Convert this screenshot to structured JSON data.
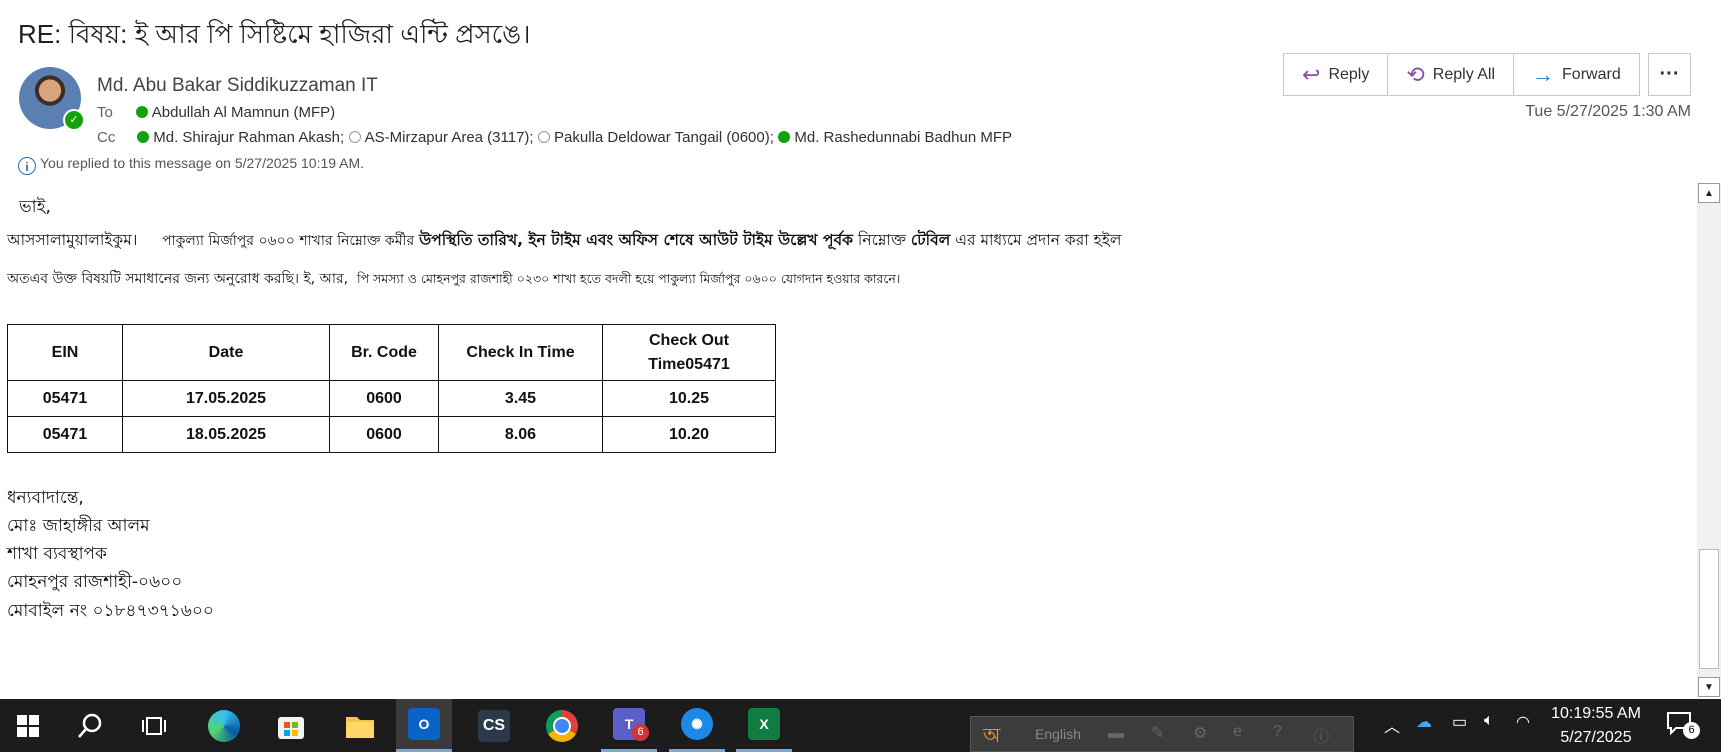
{
  "email": {
    "subject": "RE: বিষয়: ই আর পি সিষ্টিমে হাজিরা এন্টি প্রসঙে।",
    "sender": "Md. Abu Bakar Siddikuzzaman IT",
    "to_label": "To",
    "cc_label": "Cc",
    "to": [
      {
        "name": "Abdullah Al Mamnun (MFP)",
        "online": true
      }
    ],
    "cc": [
      {
        "name": "Md. Shirajur Rahman Akash;",
        "online": true
      },
      {
        "name": "AS-Mirzapur Area (3117);",
        "online": false
      },
      {
        "name": "Pakulla Deldowar Tangail (0600);",
        "online": false
      },
      {
        "name": "Md. Rashedunnabi Badhun MFP",
        "online": true
      }
    ],
    "info_icon": "info-icon",
    "info": "You replied to this message on 5/27/2025 10:19 AM.",
    "datetime": "Tue 5/27/2025 1:30 AM",
    "actions": {
      "reply": "Reply",
      "reply_all": "Reply All",
      "forward": "Forward",
      "more": "···"
    }
  },
  "body": {
    "greeting": "ভাই,",
    "line1": {
      "p1": "আসসালামুয়ালাইকুম।",
      "p2": "পাকুল্যা মির্জাপুর ০৬০০ শাখার নিম্নোক্ত কর্মীর",
      "p3": "উপস্থিতি তারিখ, ইন টাইম এবং অফিস শেষে আউট টাইম উল্লেখ পূর্বক",
      "p4": "নিম্নোক্ত",
      "p5": "টেবিল",
      "p6": "এর মাধ্যমে প্রদান করা হইল"
    },
    "line2": {
      "p1": "অতএব উক্ত বিষয়টি সমাধানের জন্য অনুরোধ করছি। ই, আর,",
      "p2": "পি সমস্যা ও মোহনপুর রাজশাহী ০২৩০ শাখা হতে বদলী হয়ে পাকুল্যা মির্জাপুর ০৬০০ যোগদান হওয়ার কারনে।"
    },
    "table": {
      "headers": [
        "EIN",
        "Date",
        "Br. Code",
        "Check In Time",
        "Check Out Time05471"
      ],
      "rows": [
        [
          "05471",
          "17.05.2025",
          "0600",
          "3.45",
          "10.25"
        ],
        [
          "05471",
          "18.05.2025",
          "0600",
          "8.06",
          "10.20"
        ]
      ]
    },
    "signature": [
      "ধন্যবাদান্তে,",
      "মোঃ জাহাঙ্গীর আলম",
      "শাখা ব্যবস্থাপক",
      "মোহনপুর রাজশাহী-০৬০০",
      "মোবাইল নং ০১৮৪৭৩৭১৬০০"
    ]
  },
  "taskbar": {
    "apps": [
      "start-icon",
      "search-icon",
      "task-view-icon",
      "edge-icon",
      "store-icon",
      "file-explorer-icon",
      "outlook-icon",
      "cs-app-icon",
      "chrome-icon",
      "teams-icon",
      "connect-app-icon",
      "excel-icon"
    ],
    "cs_label": "CS",
    "outlook_label": "O",
    "excel_label": "X",
    "teams_badge": "6",
    "language": "English",
    "clock_time": "10:19:55 AM",
    "clock_date": "5/27/2025",
    "notifications": "6"
  }
}
